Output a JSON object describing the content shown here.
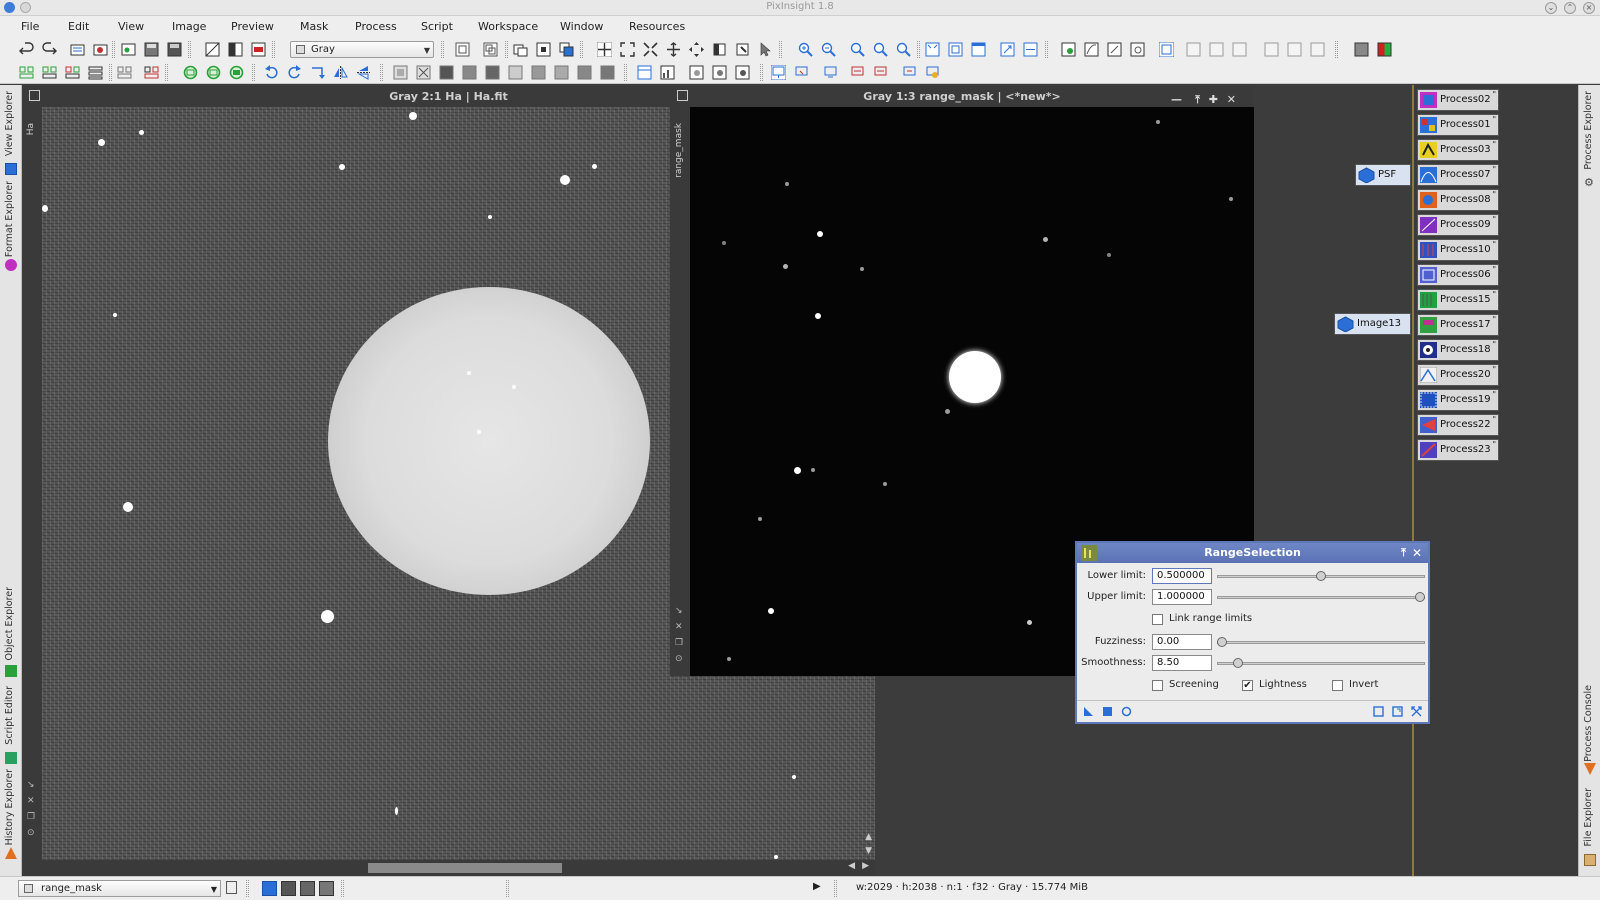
{
  "app": {
    "title": "PixInsight 1.8"
  },
  "menu": [
    "File",
    "Edit",
    "View",
    "Image",
    "Preview",
    "Mask",
    "Process",
    "Script",
    "Workspace",
    "Window",
    "Resources"
  ],
  "toolbar": {
    "view_mode": "Gray"
  },
  "left_tabs": [
    "View Explorer",
    "Format Explorer",
    "Object Explorer",
    "Script Editor",
    "History Explorer"
  ],
  "right_tabs": [
    "Process Explorer",
    "Process Console",
    "File Explorer"
  ],
  "windows": {
    "main": {
      "title": "Gray 2:1 Ha | Ha.fit",
      "id": "Ha"
    },
    "mask": {
      "title": "Gray 1:3 range_mask | <*new*>",
      "id": "range_mask"
    }
  },
  "process_icons": [
    "Process02",
    "Process01",
    "Process03",
    "Process07",
    "Process08",
    "Process09",
    "Process10",
    "Process06",
    "Process15",
    "Process17",
    "Process18",
    "Process20",
    "Process19",
    "Process22",
    "Process23"
  ],
  "floating_icons": {
    "psf": "PSF",
    "image13": "Image13"
  },
  "range_selection": {
    "title": "RangeSelection",
    "lower_label": "Lower limit:",
    "lower_value": "0.500000",
    "lower_fraction": 0.5,
    "upper_label": "Upper limit:",
    "upper_value": "1.000000",
    "upper_fraction": 1.0,
    "link_label": "Link range limits",
    "link_checked": false,
    "fuzziness_label": "Fuzziness:",
    "fuzziness_value": "0.00",
    "smoothness_label": "Smoothness:",
    "smoothness_value": "8.50",
    "screening_label": "Screening",
    "screening_checked": false,
    "lightness_label": "Lightness",
    "lightness_checked": true,
    "invert_label": "Invert",
    "invert_checked": false
  },
  "status": {
    "view_select": "range_mask",
    "info": "w:2029  ·  h:2038  ·  n:1  ·  f32  ·  Gray  ·  15.774 MiB"
  },
  "colors": {
    "dialog_header": "#5a72b4",
    "workspace": "#3c3c3c",
    "divider": "#8b7a3a"
  }
}
